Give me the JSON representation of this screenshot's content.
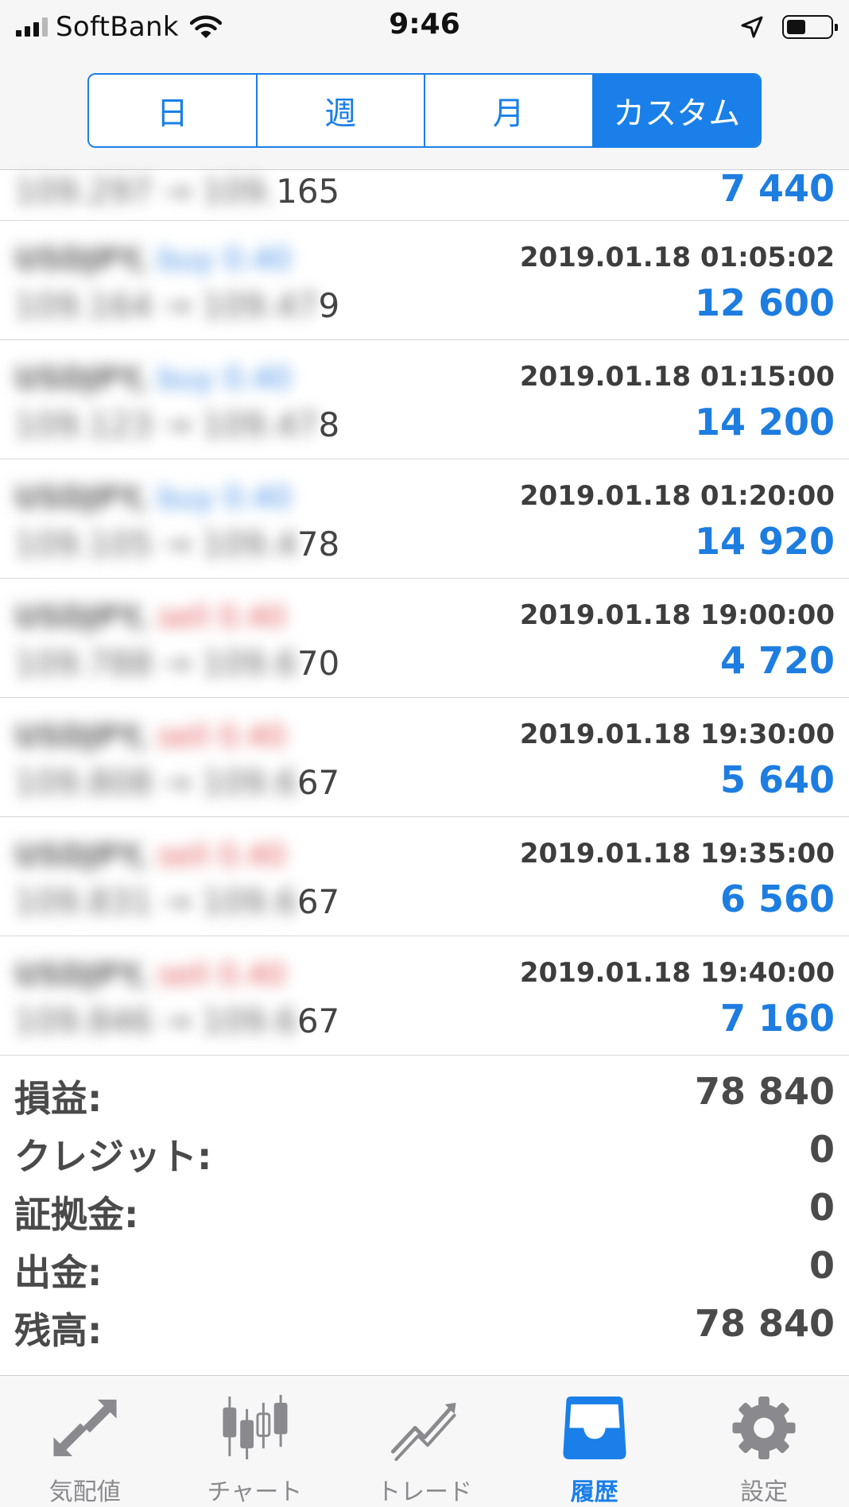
{
  "status_bar": {
    "carrier": "SoftBank",
    "time": "9:46"
  },
  "segments": [
    {
      "label": "日",
      "active": false
    },
    {
      "label": "週",
      "active": false
    },
    {
      "label": "月",
      "active": false
    },
    {
      "label": "カスタム",
      "active": true
    }
  ],
  "trades": [
    {
      "symbol": "USDJPY,",
      "side": "",
      "prices_prefix": "109.297 → 109.",
      "prices_suffix": "165",
      "time": "",
      "profit": "7 440"
    },
    {
      "symbol": "USDJPY,",
      "side": "buy 0.40",
      "prices_prefix": "109.164 → 109.47",
      "prices_suffix": "9",
      "time": "2019.01.18 01:05:02",
      "profit": "12 600"
    },
    {
      "symbol": "USDJPY,",
      "side": "buy 0.40",
      "prices_prefix": "109.123 → 109.47",
      "prices_suffix": "8",
      "time": "2019.01.18 01:15:00",
      "profit": "14 200"
    },
    {
      "symbol": "USDJPY,",
      "side": "buy 0.40",
      "prices_prefix": "109.105 → 109.4",
      "prices_suffix": "78",
      "time": "2019.01.18 01:20:00",
      "profit": "14 920"
    },
    {
      "symbol": "USDJPY,",
      "side": "sell 0.40",
      "prices_prefix": "109.788 → 109.6",
      "prices_suffix": "70",
      "time": "2019.01.18 19:00:00",
      "profit": "4 720"
    },
    {
      "symbol": "USDJPY,",
      "side": "sell 0.40",
      "prices_prefix": "109.808 → 109.6",
      "prices_suffix": "67",
      "time": "2019.01.18 19:30:00",
      "profit": "5 640"
    },
    {
      "symbol": "USDJPY,",
      "side": "sell 0.40",
      "prices_prefix": "109.831 → 109.6",
      "prices_suffix": "67",
      "time": "2019.01.18 19:35:00",
      "profit": "6 560"
    },
    {
      "symbol": "USDJPY,",
      "side": "sell 0.40",
      "prices_prefix": "109.846 → 109.6",
      "prices_suffix": "67",
      "time": "2019.01.18 19:40:00",
      "profit": "7 160"
    }
  ],
  "summary": [
    {
      "label": "損益:",
      "value": "78 840"
    },
    {
      "label": "クレジット:",
      "value": "0"
    },
    {
      "label": "証拠金:",
      "value": "0"
    },
    {
      "label": "出金:",
      "value": "0"
    },
    {
      "label": "残高:",
      "value": "78 840"
    }
  ],
  "tabs": [
    {
      "label": "気配値",
      "icon": "quotes-arrows-icon",
      "active": false
    },
    {
      "label": "チャート",
      "icon": "candlestick-chart-icon",
      "active": false
    },
    {
      "label": "トレード",
      "icon": "trade-trend-icon",
      "active": false
    },
    {
      "label": "履歴",
      "icon": "history-inbox-icon",
      "active": true
    },
    {
      "label": "設定",
      "icon": "gear-icon",
      "active": false
    }
  ],
  "colors": {
    "accent": "#1a7fe8",
    "profit": "#1d7de0",
    "buy": "#3d8ae6",
    "sell": "#e05050"
  }
}
